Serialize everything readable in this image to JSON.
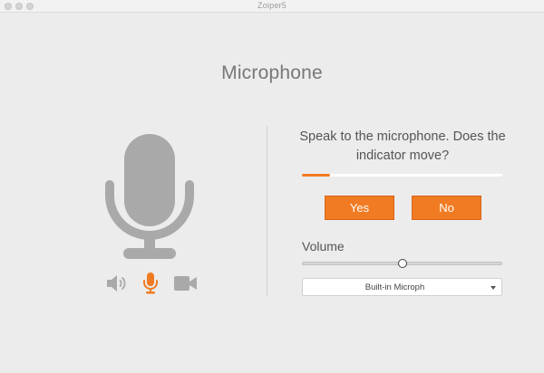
{
  "window": {
    "title": "Zoiper5"
  },
  "page": {
    "heading": "Microphone"
  },
  "left_panel": {
    "icons": [
      "speaker-icon",
      "microphone-icon",
      "video-camera-icon"
    ],
    "active_icon": "microphone-icon"
  },
  "test": {
    "question": "Speak to the microphone. Does the indicator move?",
    "level_percent": 14,
    "yes_label": "Yes",
    "no_label": "No"
  },
  "volume": {
    "label": "Volume",
    "value_percent": 50
  },
  "device_select": {
    "selected": "Built-in Microph"
  },
  "colors": {
    "accent": "#f07b22",
    "icon_gray": "#a9a9a9",
    "background": "#ececec"
  }
}
